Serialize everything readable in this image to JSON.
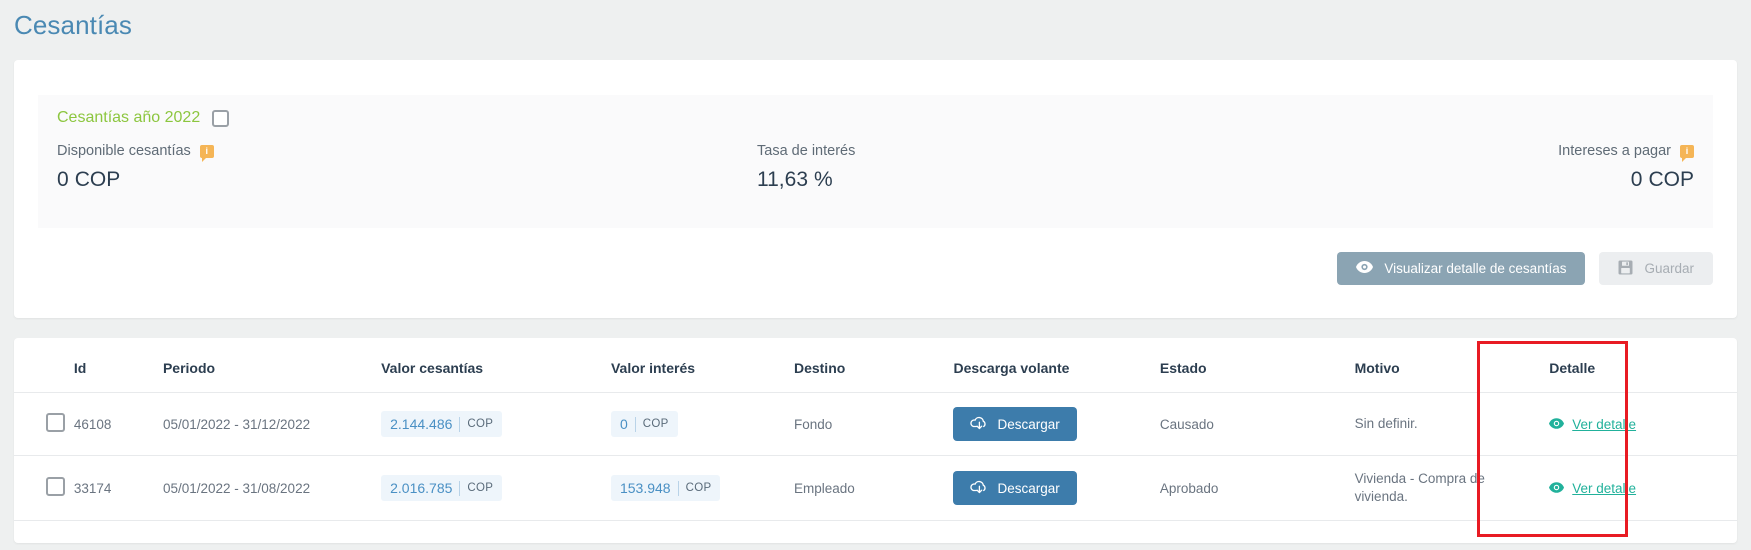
{
  "page": {
    "title": "Cesantías"
  },
  "summary": {
    "year_label": "Cesantías año 2022",
    "year_checkbox_checked": false,
    "stats": [
      {
        "label": "Disponible cesantías",
        "value": "0",
        "unit": "COP",
        "has_info_icon": true,
        "icon": "info-bubble-icon"
      },
      {
        "label": "Tasa de interés",
        "value": "11,63",
        "unit": "%",
        "has_info_icon": false,
        "icon": ""
      },
      {
        "label": "Intereses a pagar",
        "value": "0",
        "unit": "COP",
        "has_info_icon": true,
        "icon": "info-bubble-icon"
      }
    ]
  },
  "actions": {
    "view_detail_label": "Visualizar detalle de cesantías",
    "view_detail_icon": "eye-icon",
    "save_label": "Guardar",
    "save_icon": "floppy-save-icon",
    "save_disabled": true
  },
  "table": {
    "columns": [
      {
        "key": "select",
        "label": ""
      },
      {
        "key": "id",
        "label": "Id"
      },
      {
        "key": "periodo",
        "label": "Periodo"
      },
      {
        "key": "valor_cesantias",
        "label": "Valor cesantías"
      },
      {
        "key": "valor_interes",
        "label": "Valor interés"
      },
      {
        "key": "destino",
        "label": "Destino"
      },
      {
        "key": "descarga_volante",
        "label": "Descarga volante"
      },
      {
        "key": "estado",
        "label": "Estado"
      },
      {
        "key": "motivo",
        "label": "Motivo"
      },
      {
        "key": "detalle",
        "label": "Detalle"
      }
    ],
    "rows": [
      {
        "selected": false,
        "id": "46108",
        "periodo": "05/01/2022 - 31/12/2022",
        "valor_cesantias": "2.144.486",
        "valor_cesantias_currency": "COP",
        "valor_interes": "0",
        "valor_interes_currency": "COP",
        "destino": "Fondo",
        "download_label": "Descargar",
        "download_icon": "cloud-download-icon",
        "estado": "Causado",
        "motivo": "Sin definir.",
        "detalle_label": "Ver detalle",
        "detalle_icon": "eye-icon"
      },
      {
        "selected": false,
        "id": "33174",
        "periodo": "05/01/2022 - 31/08/2022",
        "valor_cesantias": "2.016.785",
        "valor_cesantias_currency": "COP",
        "valor_interes": "153.948",
        "valor_interes_currency": "COP",
        "destino": "Empleado",
        "download_label": "Descargar",
        "download_icon": "cloud-download-icon",
        "estado": "Aprobado",
        "motivo": "Vivienda - Compra de vivienda.",
        "detalle_label": "Ver detalle",
        "detalle_icon": "eye-icon"
      }
    ]
  },
  "annotation": {
    "shape": "rectangle",
    "color": "#e81b23",
    "target_column": "Detalle"
  },
  "colors": {
    "page_background": "#eef0f0",
    "card_background": "#ffffff",
    "title_blue": "#4a89b3",
    "year_green": "#8cc63f",
    "info_orange": "#f5b556",
    "button_ghost": "#8ba4b3",
    "button_download": "#3d7cab",
    "link_teal": "#21b19b",
    "money_chip_bg": "#eef5fb",
    "money_text": "#4a90c4",
    "annotation_red": "#e81b23"
  }
}
